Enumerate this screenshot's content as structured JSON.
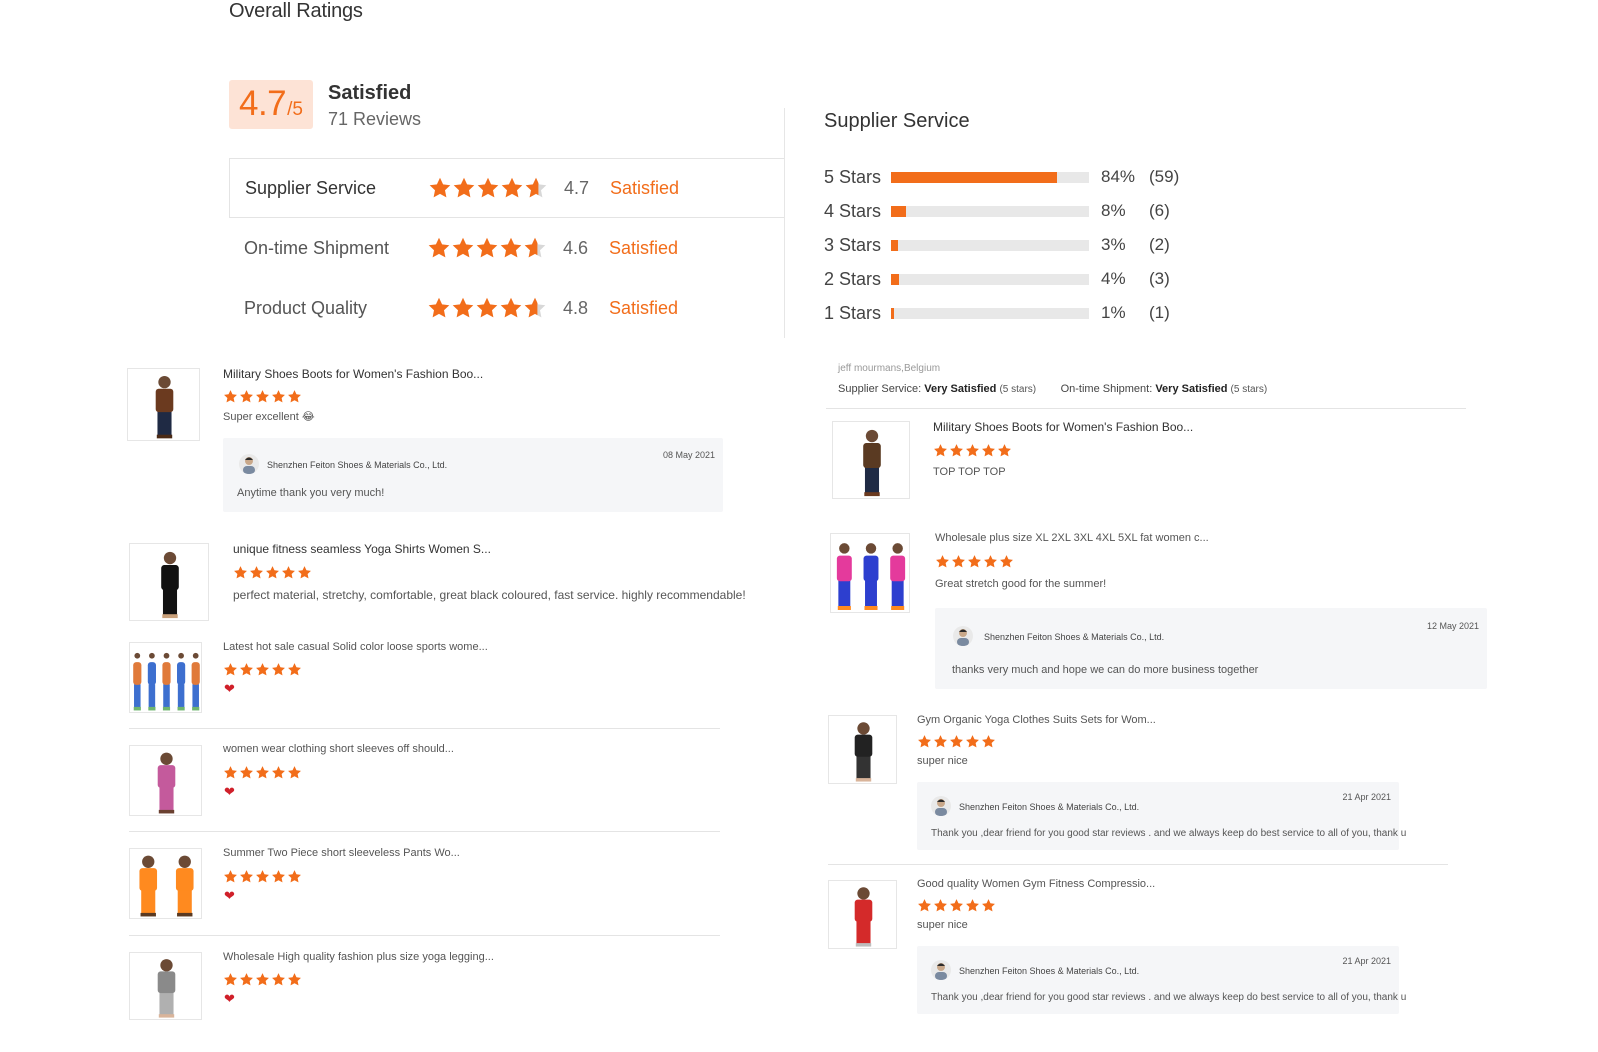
{
  "header": {
    "title": "Overall Ratings"
  },
  "overall": {
    "score": "4.7",
    "out_of": "/5",
    "label": "Satisfied",
    "reviews": "71 Reviews"
  },
  "categories": [
    {
      "name": "Supplier Service",
      "score": "4.7",
      "status": "Satisfied",
      "stars": 4.7
    },
    {
      "name": "On-time Shipment",
      "score": "4.6",
      "status": "Satisfied",
      "stars": 4.6
    },
    {
      "name": "Product Quality",
      "score": "4.8",
      "status": "Satisfied",
      "stars": 4.8
    }
  ],
  "distribution": {
    "title": "Supplier Service",
    "rows": [
      {
        "label": "5 Stars",
        "percent": 84,
        "percent_text": "84%",
        "count": "(59)"
      },
      {
        "label": "4 Stars",
        "percent": 8,
        "percent_text": "8%",
        "count": "(6)"
      },
      {
        "label": "3 Stars",
        "percent": 3,
        "percent_text": "3%",
        "count": "(2)"
      },
      {
        "label": "2 Stars",
        "percent": 4,
        "percent_text": "4%",
        "count": "(3)"
      },
      {
        "label": "1 Stars",
        "percent": 1,
        "percent_text": "1%",
        "count": "(1)"
      }
    ]
  },
  "left_reviews": [
    {
      "title": "Military Shoes Boots for Women's Fashion Boo...",
      "stars": 5,
      "comment": "Super excellent 😂",
      "reply": {
        "company": "Shenzhen Feiton Shoes & Materials Co., Ltd.",
        "date": "08 May 2021",
        "text": "Anytime thank you very much!"
      }
    },
    {
      "title": "unique fitness seamless Yoga Shirts Women S...",
      "stars": 5,
      "comment": "perfect material, stretchy, comfortable, great black coloured, fast service. highly recommendable!"
    },
    {
      "title": "Latest hot sale casual Solid color loose sports wome...",
      "stars": 5,
      "comment": "❤"
    },
    {
      "title": "women wear clothing short sleeves off should...",
      "stars": 5,
      "comment": "❤"
    },
    {
      "title": "Summer Two Piece short sleeveless Pants Wo...",
      "stars": 5,
      "comment": "❤"
    },
    {
      "title": "Wholesale High quality fashion plus size yoga legging...",
      "stars": 5,
      "comment": "❤"
    }
  ],
  "buyer": {
    "name": "jeff mourmans,Belgium",
    "supplier_service_label": "Supplier Service:",
    "supplier_service_value": "Very Satisfied",
    "supplier_service_stars": "(5 stars)",
    "shipment_label": "On-time Shipment:",
    "shipment_value": "Very Satisfied",
    "shipment_stars": "(5 stars)"
  },
  "right_reviews": [
    {
      "title": "Military Shoes Boots for Women's Fashion Boo...",
      "stars": 5,
      "comment": "TOP TOP TOP"
    },
    {
      "title": "Wholesale plus size XL 2XL 3XL 4XL 5XL fat women c...",
      "stars": 5,
      "comment": "Great stretch good for the summer!",
      "reply": {
        "company": "Shenzhen Feiton Shoes & Materials Co., Ltd.",
        "date": "12 May 2021",
        "text": "thanks very much and hope we can do more business together"
      }
    },
    {
      "title": "Gym Organic Yoga Clothes Suits Sets for Wom...",
      "stars": 5,
      "comment": "super nice",
      "reply": {
        "company": "Shenzhen Feiton Shoes & Materials Co., Ltd.",
        "date": "21 Apr 2021",
        "text": "Thank you ,dear friend for you good star reviews . and we always keep do best service to all of you, thank u"
      }
    },
    {
      "title": "Good quality Women Gym Fitness Compressio...",
      "stars": 5,
      "comment": "super nice",
      "reply": {
        "company": "Shenzhen Feiton Shoes & Materials Co., Ltd.",
        "date": "21 Apr 2021",
        "text": "Thank you ,dear friend for you good star reviews . and we always keep do best service to all of you, thank u"
      }
    }
  ],
  "colors": {
    "accent": "#f26d1a",
    "score_bg": "#fde3d6",
    "bar_bg": "#e8e8e8",
    "heart": "#d0202a"
  },
  "icons": {
    "star": "star-icon",
    "half_star": "half-star-icon",
    "heart": "heart-icon",
    "avatar": "avatar-icon"
  }
}
